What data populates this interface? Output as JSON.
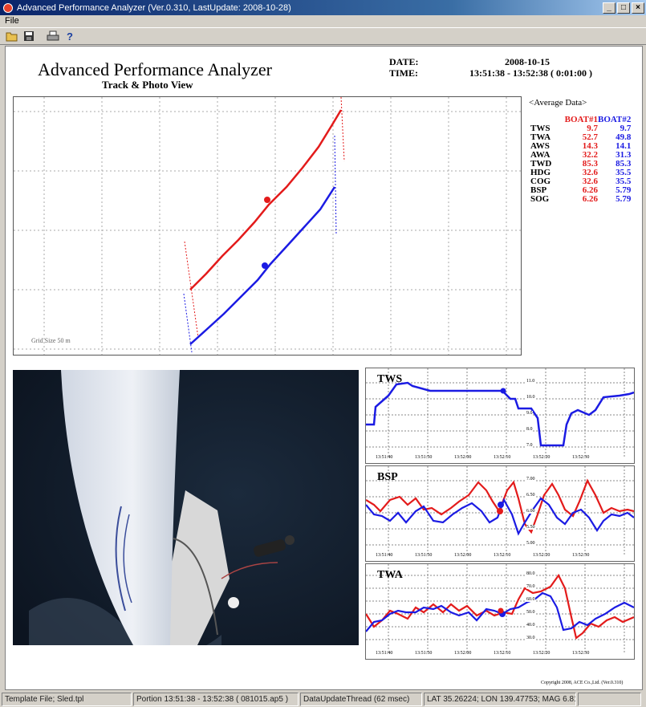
{
  "window": {
    "title": "Advanced Performance Analyzer (Ver.0.310, LastUpdate: 2008-10-28)"
  },
  "menu": {
    "file": "File"
  },
  "header": {
    "app_name": "Advanced Performance Analyzer",
    "subtitle": "Track & Photo View",
    "date_label": "DATE:",
    "date_value": "2008-10-15",
    "time_label": "TIME:",
    "time_value": "13:51:38 - 13:52:38 ( 0:01:00 )"
  },
  "track": {
    "grid_label": "Grid Size 50 m",
    "colors": {
      "boat1": "#e31b1b",
      "boat2": "#1b1be3"
    }
  },
  "average": {
    "title": "<Average Data>",
    "headers": [
      "BOAT#1",
      "BOAT#2"
    ],
    "rows": [
      {
        "label": "TWS",
        "b1": "9.7",
        "b2": "9.7"
      },
      {
        "label": "TWA",
        "b1": "52.7",
        "b2": "49.8"
      },
      {
        "label": "AWS",
        "b1": "14.3",
        "b2": "14.1"
      },
      {
        "label": "AWA",
        "b1": "32.2",
        "b2": "31.3"
      },
      {
        "label": "TWD",
        "b1": "85.3",
        "b2": "85.3"
      },
      {
        "label": "HDG",
        "b1": "32.6",
        "b2": "35.5"
      },
      {
        "label": "COG",
        "b1": "32.6",
        "b2": "35.5"
      },
      {
        "label": "BSP",
        "b1": "6.26",
        "b2": "5.79"
      },
      {
        "label": "SOG",
        "b1": "6.26",
        "b2": "5.79"
      }
    ]
  },
  "charts": {
    "tws": {
      "title": "TWS",
      "y_ticks": [
        "11.0",
        "10.0",
        "9.0",
        "8.0",
        "7.0"
      ],
      "x_ticks": [
        "13:51:40",
        "13:51:50",
        "13:52:00",
        "13:52:10",
        "13:52:20",
        "13:52:30"
      ]
    },
    "bsp": {
      "title": "BSP",
      "y_ticks": [
        "7.00",
        "6.50",
        "6.00",
        "5.50",
        "5.00"
      ],
      "x_ticks": [
        "13:51:40",
        "13:51:50",
        "13:52:00",
        "13:52:10",
        "13:52:20",
        "13:52:30"
      ]
    },
    "twa": {
      "title": "TWA",
      "y_ticks": [
        "80.0",
        "70.0",
        "60.0",
        "50.0",
        "40.0",
        "30.0"
      ],
      "x_ticks": [
        "13:51:40",
        "13:51:50",
        "13:52:00",
        "13:52:10",
        "13:52:20",
        "13:52:30"
      ]
    }
  },
  "copyright": "Copyright 2008, ACE Co.,Ltd. (Ver.0.310)",
  "status": {
    "template": "Template File; Sled.tpl",
    "portion": "Portion 13:51:38 - 13:52:38 ( 081015.ap5 )",
    "thread": "DataUpdateThread (62 msec)",
    "position": "LAT 35.26224; LON 139.47753; MAG 6.81"
  }
}
